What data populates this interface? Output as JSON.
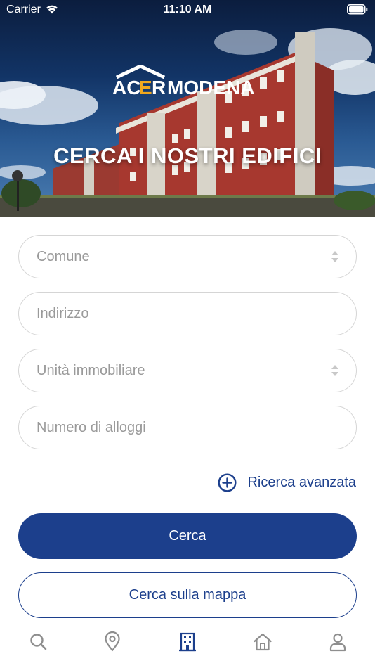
{
  "status_bar": {
    "carrier": "Carrier",
    "time": "11:10 AM",
    "wifi_icon": "wifi-icon",
    "battery_icon": "battery-icon"
  },
  "header": {
    "logo_text": "ACERMODENA",
    "title": "CERCA I NOSTRI EDIFICI"
  },
  "form": {
    "comune": "Comune",
    "indirizzo": "Indirizzo",
    "unita": "Unità immobiliare",
    "alloggi": "Numero di alloggi",
    "advanced_label": "Ricerca avanzata"
  },
  "actions": {
    "search": "Cerca",
    "search_map": "Cerca sulla mappa"
  },
  "tabbar": {
    "items": [
      {
        "icon": "search-icon",
        "active": false
      },
      {
        "icon": "location-pin-icon",
        "active": false
      },
      {
        "icon": "building-icon",
        "active": true
      },
      {
        "icon": "home-icon",
        "active": false
      },
      {
        "icon": "user-icon",
        "active": false
      }
    ]
  },
  "colors": {
    "primary": "#1c3f8c",
    "placeholder": "#9a9a9a",
    "border": "#d5d5d5",
    "inactive_icon": "#8e8e8e",
    "logo_accent": "#f0a81e"
  }
}
